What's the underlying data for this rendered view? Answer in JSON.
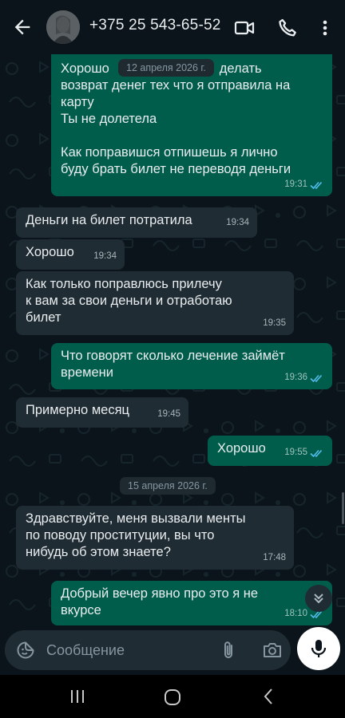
{
  "header": {
    "contact": "+375 25 543-65-52",
    "back_icon": "arrow-left-icon",
    "video_icon": "video-camera-icon",
    "call_icon": "phone-icon",
    "menu_icon": "more-vertical-icon"
  },
  "messages": [
    {
      "dir": "out",
      "text": "Хорошо [hidden] делать\nвозврат денег тех что я отправила на карту\nТы не долетела\n\nКак поправишся отпишешь я лично буду брать билет не переводя деньги",
      "time": "19:31",
      "read": true
    },
    {
      "dir": "in",
      "text": "Деньги на билет потратила",
      "time": "19:34"
    },
    {
      "dir": "in",
      "text": "Хорошо",
      "time": "19:34"
    },
    {
      "dir": "in",
      "text": "Как только поправлюсь прилечу\nк вам за свои деньги и отработаю билет",
      "time": "19:35"
    },
    {
      "dir": "out",
      "text": "Что говорят сколько лечение займёт времени",
      "time": "19:36",
      "read": true
    },
    {
      "dir": "in",
      "text": "Примерно месяц",
      "time": "19:45"
    },
    {
      "dir": "out",
      "text": "Хорошо",
      "time": "19:55",
      "read": true
    },
    {
      "dir": "in",
      "text": "Здравствуйте, меня вызвали менты по поводу проституции, вы что нибудь об этом знаете?",
      "time": "17:48"
    },
    {
      "dir": "out",
      "text": "Добрый вечер явно про это я не вкурсе",
      "time": "18:10",
      "read": true
    }
  ],
  "bubble_texts": {
    "m1_line1a": "Хорошо",
    "m1_line1b": "делать",
    "m1_rest": "возврат денег тех что я отправила на\nкарту\nТы не долетела\n\nКак поправишся отпишешь я лично\nбуду брать билет не переводя деньги",
    "m2": "Деньги на билет потратила",
    "m3": "Хорошо",
    "m4": "Как только поправлюсь прилечу\nк вам за свои деньги и отработаю\nбилет",
    "m5": "Что говорят сколько лечение займёт\nвремени",
    "m6": "Примерно месяц",
    "m7": "Хорошо",
    "m8": "Здравствуйте, меня вызвали менты\nпо поводу проституции, вы что\nнибудь об этом знаете?",
    "m9": "Добрый вечер явно про это я не\nвкурсе"
  },
  "date_labels": {
    "floating": "12 апреля 2026 г.",
    "separator": "15 апреля 2026 г."
  },
  "composer": {
    "placeholder": "Сообщение",
    "emoji_icon": "sticker-icon",
    "attach_icon": "paperclip-icon",
    "camera_icon": "camera-icon",
    "mic_icon": "microphone-icon"
  },
  "navbar": {
    "recents_icon": "recents-icon",
    "home_icon": "home-icon",
    "back_icon": "back-icon"
  },
  "colors": {
    "background": "#0b141a",
    "outgoing_bubble": "#005c4b",
    "incoming_bubble": "#202c33",
    "read_ticks": "#53bdeb",
    "composer": "#1f2c34"
  }
}
